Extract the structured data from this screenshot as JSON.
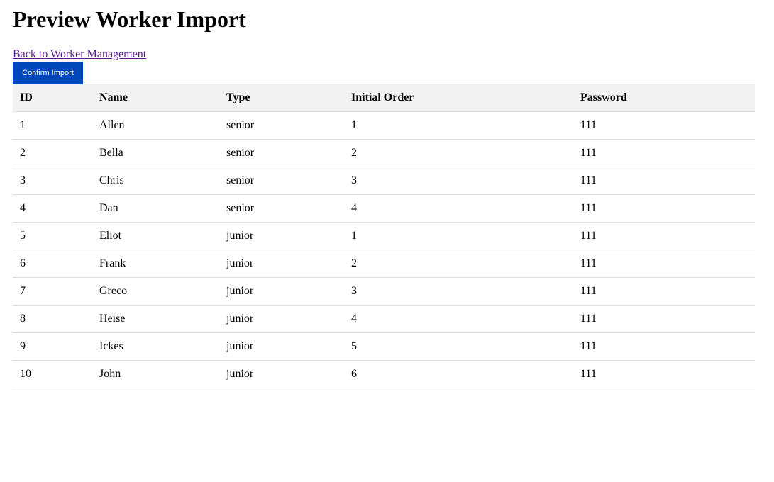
{
  "page": {
    "title": "Preview Worker Import",
    "back_link": "Back to Worker Management",
    "confirm_button": "Confirm Import"
  },
  "colors": {
    "accent": "#0047bb",
    "header_bg": "#f2f2f2",
    "row_border": "#dddddd",
    "visited_link": "#551a8b"
  },
  "table": {
    "columns": [
      "ID",
      "Name",
      "Type",
      "Initial Order",
      "Password"
    ],
    "rows": [
      [
        "1",
        "Allen",
        "senior",
        "1",
        "111"
      ],
      [
        "2",
        "Bella",
        "senior",
        "2",
        "111"
      ],
      [
        "3",
        "Chris",
        "senior",
        "3",
        "111"
      ],
      [
        "4",
        "Dan",
        "senior",
        "4",
        "111"
      ],
      [
        "5",
        "Eliot",
        "junior",
        "1",
        "111"
      ],
      [
        "6",
        "Frank",
        "junior",
        "2",
        "111"
      ],
      [
        "7",
        "Greco",
        "junior",
        "3",
        "111"
      ],
      [
        "8",
        "Heise",
        "junior",
        "4",
        "111"
      ],
      [
        "9",
        "Ickes",
        "junior",
        "5",
        "111"
      ],
      [
        "10",
        "John",
        "junior",
        "6",
        "111"
      ]
    ]
  }
}
